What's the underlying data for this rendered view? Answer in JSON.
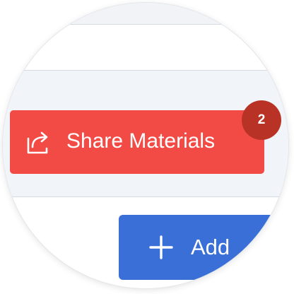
{
  "colors": {
    "share_button": "#f24b45",
    "badge": "#b83326",
    "add_button": "#3b6fd8"
  },
  "share_button": {
    "label": "Share Materials",
    "icon": "share-export-icon",
    "badge_count": "2"
  },
  "add_button": {
    "label": "Add",
    "icon": "plus-icon"
  }
}
